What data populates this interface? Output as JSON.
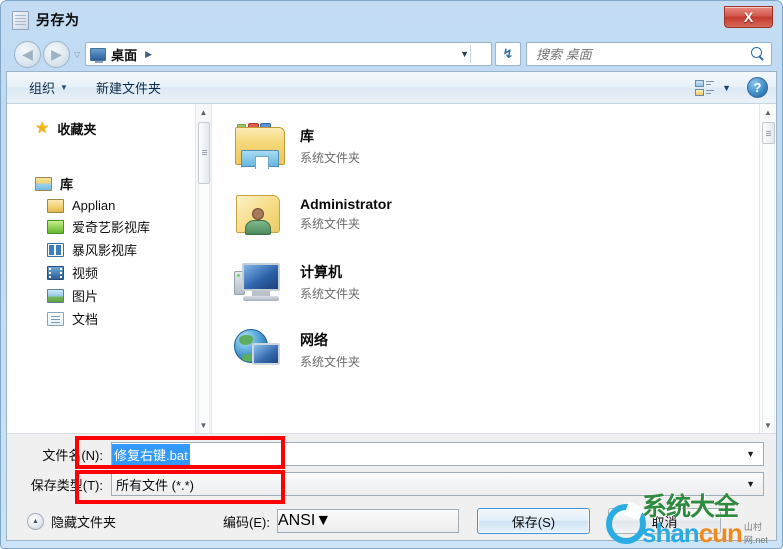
{
  "window": {
    "title": "另存为",
    "close_label": "X"
  },
  "nav": {
    "back_arrow": "◀",
    "forward_arrow": "▶",
    "history_caret": "▽",
    "address_value": "桌面",
    "address_separator": "▶",
    "address_caret": "▼",
    "refresh_icon": "↯",
    "search_placeholder": "搜索 桌面"
  },
  "toolbar": {
    "organize_label": "组织",
    "organize_caret": "▼",
    "new_folder_label": "新建文件夹",
    "view_caret": "▼",
    "help_label": "?"
  },
  "sidebar": {
    "favorites": {
      "label": "收藏夹",
      "icon": "star-icon"
    },
    "libraries": {
      "label": "库",
      "icon": "library-folder-icon"
    },
    "items": [
      {
        "label": "Applian",
        "icon": "folder-icon"
      },
      {
        "label": "爱奇艺影视库",
        "icon": "iqiyi-icon"
      },
      {
        "label": "暴风影视库",
        "icon": "baofeng-icon"
      },
      {
        "label": "视频",
        "icon": "video-icon"
      },
      {
        "label": "图片",
        "icon": "picture-icon"
      },
      {
        "label": "文档",
        "icon": "document-icon"
      }
    ],
    "scroll_up": "▲",
    "scroll_down": "▼"
  },
  "filelist": {
    "scroll_up": "▲",
    "scroll_down": "▼",
    "items": [
      {
        "name": "库",
        "type": "系统文件夹",
        "icon": "library-icon"
      },
      {
        "name": "Administrator",
        "type": "系统文件夹",
        "icon": "user-folder-icon"
      },
      {
        "name": "计算机",
        "type": "系统文件夹",
        "icon": "computer-icon"
      },
      {
        "name": "网络",
        "type": "系统文件夹",
        "icon": "network-icon"
      }
    ]
  },
  "form": {
    "filename_label": "文件名(N):",
    "filename_value": "修复右键.bat",
    "filetype_label": "保存类型(T):",
    "filetype_value": "所有文件  (*.*)",
    "dropdown_caret": "▼"
  },
  "footer": {
    "hide_folders_label": "隐藏文件夹",
    "hide_folders_caret": "▲",
    "encoding_label": "编码(E):",
    "encoding_value": "ANSI",
    "save_label": "保存(S)",
    "cancel_label": "取消"
  },
  "watermark": {
    "cn_text": "系统大全",
    "en_left": "shan",
    "en_right": "cun",
    "sub_text": "山村网.net"
  },
  "colors": {
    "accent": "#3399ff",
    "annotation": "#ff0000",
    "title_bar": "#bfd9f2",
    "close_button": "#c33b2e"
  }
}
